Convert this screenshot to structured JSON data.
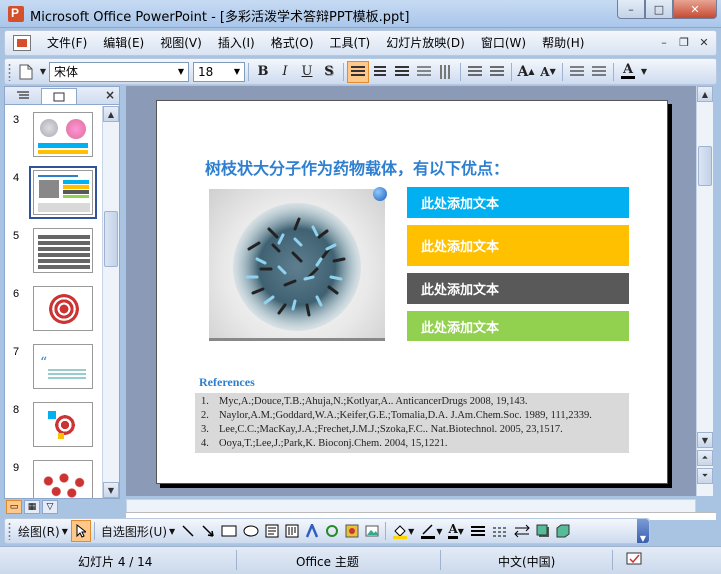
{
  "window": {
    "title": "Microsoft Office PowerPoint - [多彩活泼学术答辩PPT模板.ppt]",
    "min_label": "–",
    "max_label": "□",
    "close_label": "✕"
  },
  "menu": {
    "items": [
      "文件(F)",
      "编辑(E)",
      "视图(V)",
      "插入(I)",
      "格式(O)",
      "工具(T)",
      "幻灯片放映(D)",
      "窗口(W)",
      "帮助(H)"
    ]
  },
  "toolbar": {
    "font_name": "宋体",
    "font_size": "18",
    "bold_label": "B",
    "italic_label": "I",
    "underline_label": "U",
    "shadow_label": "S",
    "grow_label": "A",
    "shrink_label": "A",
    "color_label": "A"
  },
  "slides_panel": {
    "close_label": "×",
    "thumbnails": [
      {
        "number": "3"
      },
      {
        "number": "4",
        "selected": true
      },
      {
        "number": "5"
      },
      {
        "number": "6"
      },
      {
        "number": "7"
      },
      {
        "number": "8"
      },
      {
        "number": "9"
      }
    ]
  },
  "slide": {
    "title": "树枝状大分子作为药物载体，有以下优点：",
    "bars": [
      {
        "text": "此处添加文本",
        "color": "#00b0f0"
      },
      {
        "text": "此处添加文本",
        "color": "#ffc000"
      },
      {
        "text": "此处添加文本",
        "color": "#595959"
      },
      {
        "text": "此处添加文本",
        "color": "#92d050"
      }
    ],
    "references_title": "References",
    "references": [
      {
        "n": "1.",
        "text": "Myc,A.;Douce,T.B.;Ahuja,N.;Kotlyar,A.. AnticancerDrugs 2008, 19,143."
      },
      {
        "n": "2.",
        "text": "Naylor,A.M.;Goddard,W.A.;Keifer,G.E.;Tomalia,D.A. J.Am.Chem.Soc. 1989, 111,2339."
      },
      {
        "n": "3.",
        "text": "Lee,C.C.;MacKay,J.A.;Frechet,J.M.J.;Szoka,F.C..  Nat.Biotechnol. 2005, 23,1517."
      },
      {
        "n": "4.",
        "text": "Ooya,T.;Lee,J.;Park,K. Bioconj.Chem. 2004, 15,1221."
      }
    ]
  },
  "drawing_toolbar": {
    "draw_label": "绘图(R)",
    "autoshapes_label": "自选图形(U)"
  },
  "status": {
    "slide_position": "幻灯片 4 / 14",
    "theme": "Office 主题",
    "language": "中文(中国)"
  },
  "colors": {
    "title_blue": "#2f7fd0",
    "selection_orange": "#ffc78a"
  }
}
